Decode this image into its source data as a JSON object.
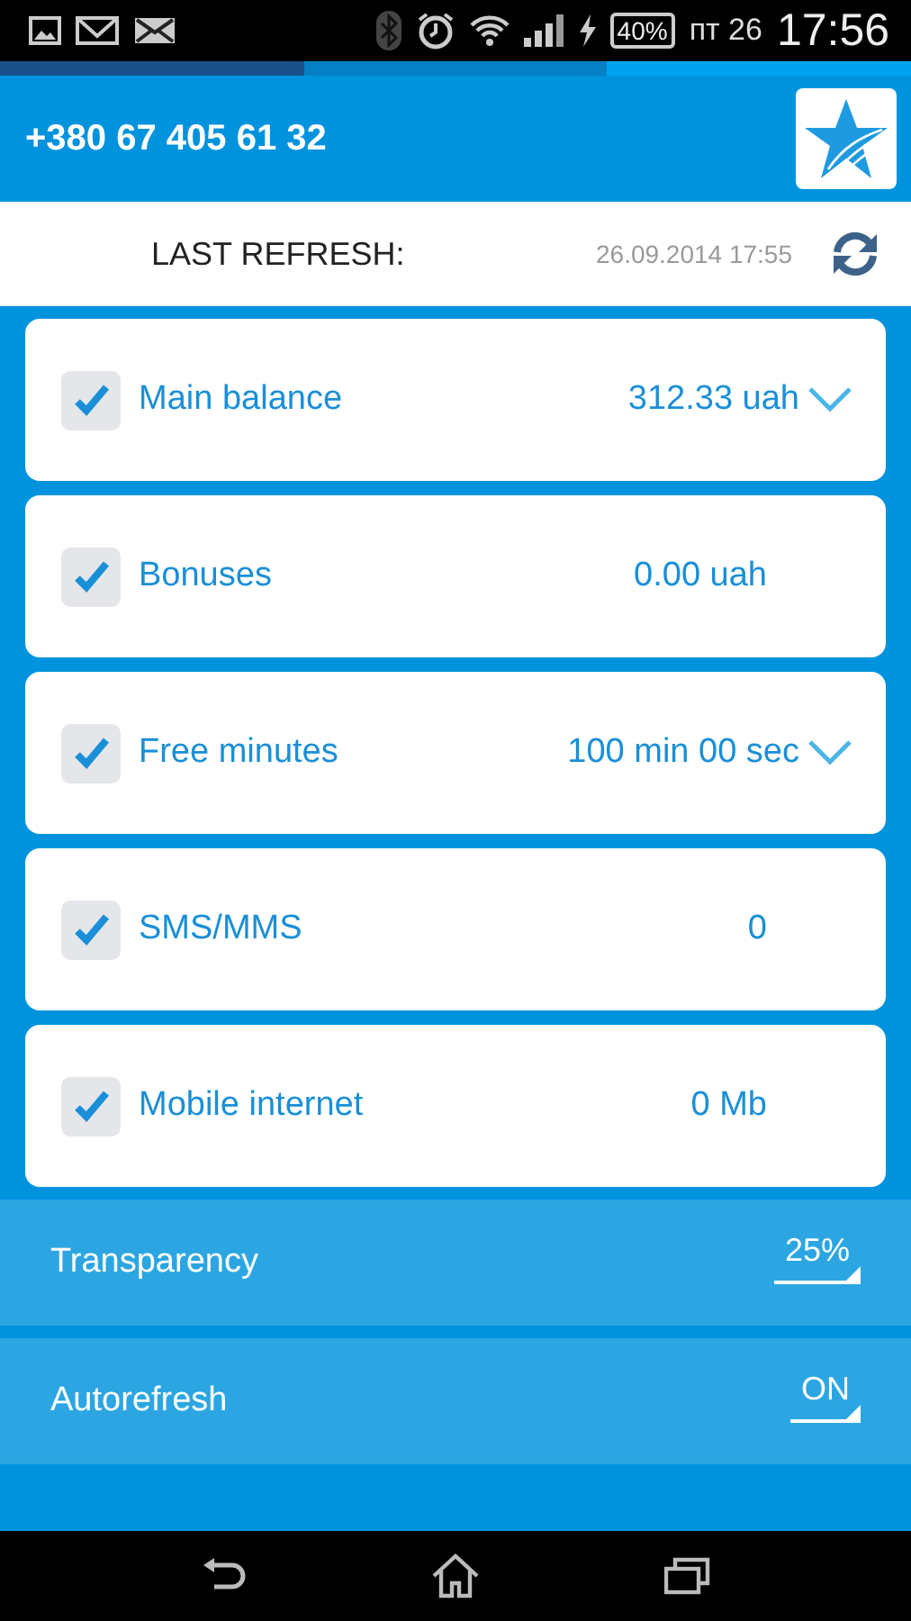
{
  "status_bar": {
    "battery": "40%",
    "day": "пт 26",
    "time": "17:56"
  },
  "header": {
    "phone": "+380 67 405 61 32"
  },
  "refresh": {
    "label": "LAST REFRESH:",
    "timestamp": "26.09.2014 17:55"
  },
  "counters": [
    {
      "name": "Main balance",
      "value": "312.33 uah",
      "checked": true,
      "has_details": true
    },
    {
      "name": "Bonuses",
      "value": "0.00 uah",
      "checked": true,
      "has_details": false
    },
    {
      "name": "Free minutes",
      "value": "100 min 00 sec",
      "checked": true,
      "has_details": true
    },
    {
      "name": "SMS/MMS",
      "value": "0",
      "checked": true,
      "has_details": false
    },
    {
      "name": "Mobile internet",
      "value": "0 Mb",
      "checked": true,
      "has_details": false
    }
  ],
  "settings": [
    {
      "label": "Transparency",
      "value": "25%"
    },
    {
      "label": "Autorefresh",
      "value": "ON"
    }
  ]
}
